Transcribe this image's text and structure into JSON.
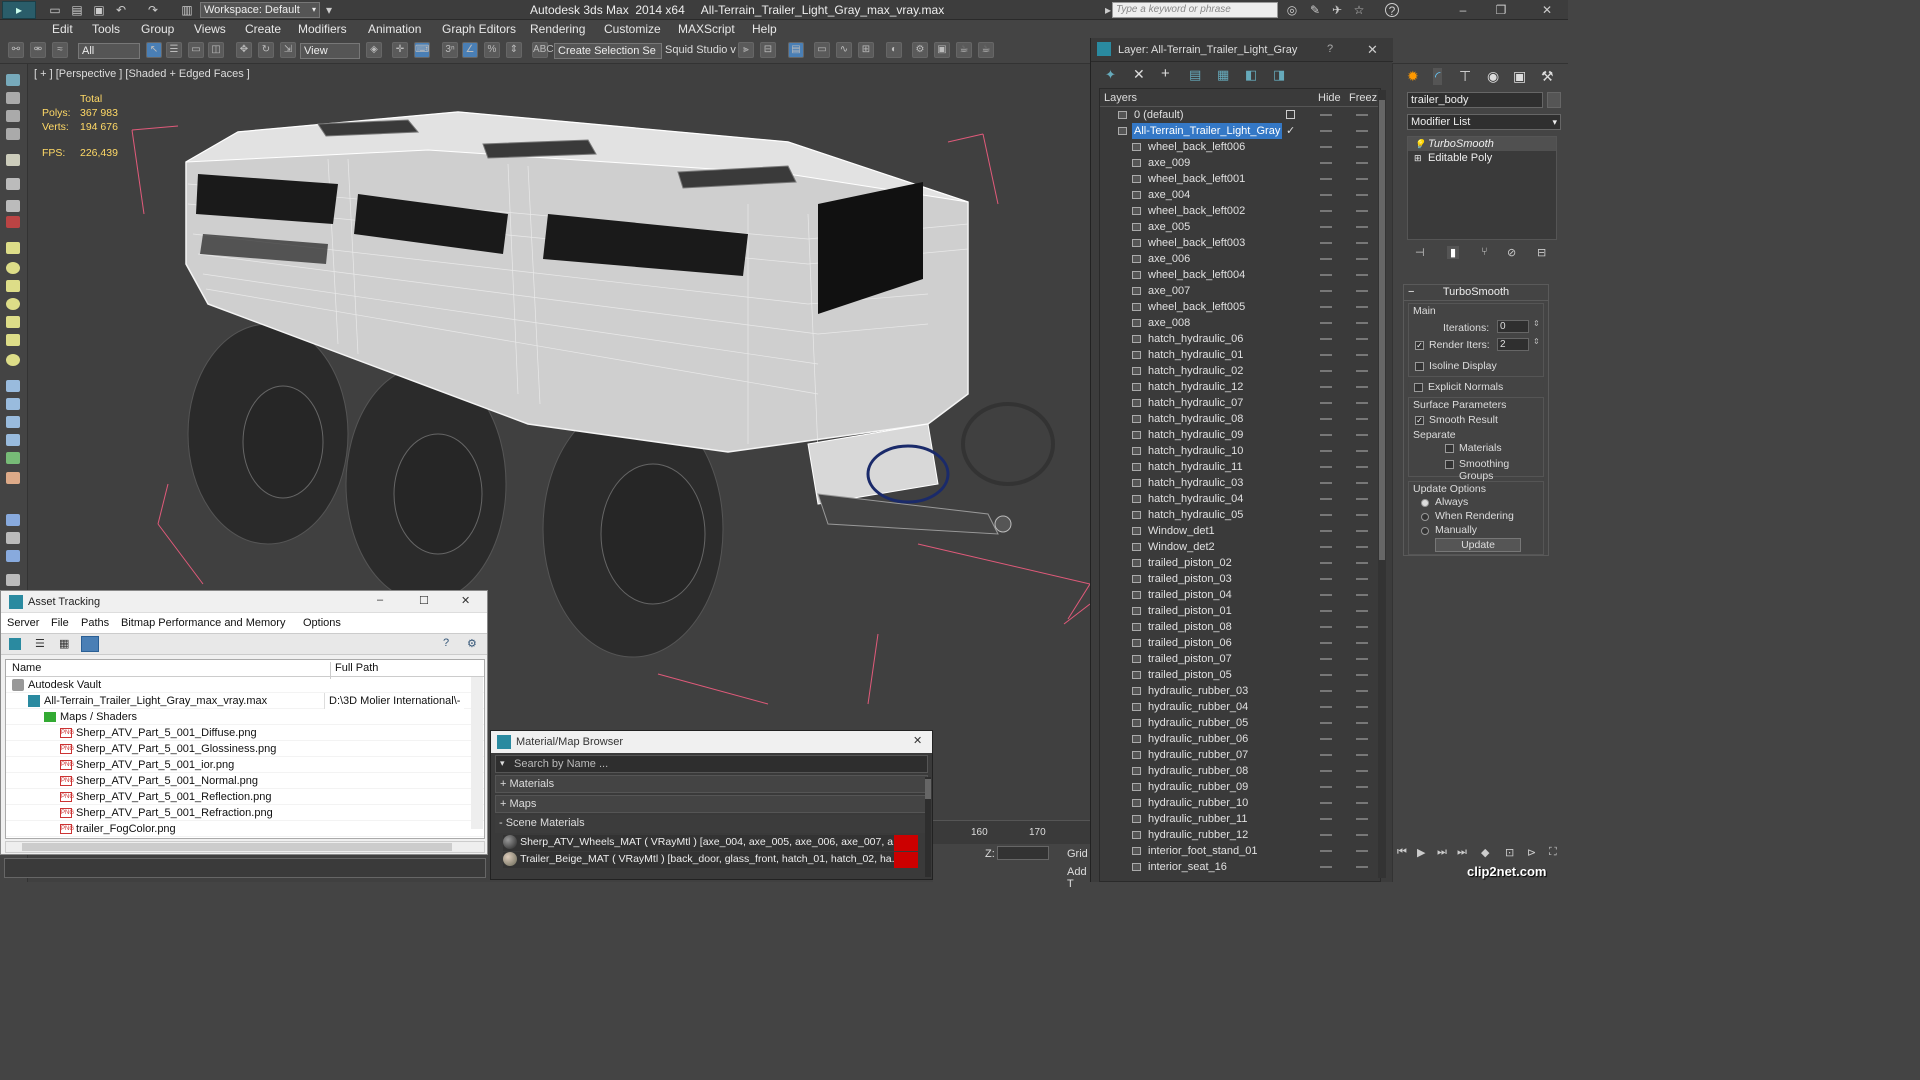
{
  "titlebar": {
    "workspace": "Workspace: Default",
    "title": "Autodesk 3ds Max  2014 x64     All-Terrain_Trailer_Light_Gray_max_vray.max",
    "search_placeholder": "Type a keyword or phrase"
  },
  "menu": [
    "Edit",
    "Tools",
    "Group",
    "Views",
    "Create",
    "Modifiers",
    "Animation",
    "Graph Editors",
    "Rendering",
    "Customize",
    "MAXScript",
    "Help"
  ],
  "toolbar": {
    "filter_value": "All",
    "view_value": "View",
    "selection_set": "Create Selection Se",
    "studio_label": "Squid Studio v"
  },
  "viewport": {
    "label": "[ + ] [Perspective ] [Shaded + Edged Faces ]",
    "stats": {
      "total_label": "Total",
      "polys_label": "Polys:",
      "polys_value": "367 983",
      "verts_label": "Verts:",
      "verts_value": "194 676",
      "fps_label": "FPS:",
      "fps_value": "226,439"
    }
  },
  "layer_panel": {
    "title": "Layer: All-Terrain_Trailer_Light_Gray",
    "col_layers": "Layers",
    "col_hide": "Hide",
    "col_freeze": "Freez",
    "layers": [
      {
        "name": "0 (default)",
        "indent": 1,
        "selected": false
      },
      {
        "name": "All-Terrain_Trailer_Light_Gray",
        "indent": 1,
        "selected": true
      },
      {
        "name": "wheel_back_left006",
        "indent": 2
      },
      {
        "name": "axe_009",
        "indent": 2
      },
      {
        "name": "wheel_back_left001",
        "indent": 2
      },
      {
        "name": "axe_004",
        "indent": 2
      },
      {
        "name": "wheel_back_left002",
        "indent": 2
      },
      {
        "name": "axe_005",
        "indent": 2
      },
      {
        "name": "wheel_back_left003",
        "indent": 2
      },
      {
        "name": "axe_006",
        "indent": 2
      },
      {
        "name": "wheel_back_left004",
        "indent": 2
      },
      {
        "name": "axe_007",
        "indent": 2
      },
      {
        "name": "wheel_back_left005",
        "indent": 2
      },
      {
        "name": "axe_008",
        "indent": 2
      },
      {
        "name": "hatch_hydraulic_06",
        "indent": 2
      },
      {
        "name": "hatch_hydraulic_01",
        "indent": 2
      },
      {
        "name": "hatch_hydraulic_02",
        "indent": 2
      },
      {
        "name": "hatch_hydraulic_12",
        "indent": 2
      },
      {
        "name": "hatch_hydraulic_07",
        "indent": 2
      },
      {
        "name": "hatch_hydraulic_08",
        "indent": 2
      },
      {
        "name": "hatch_hydraulic_09",
        "indent": 2
      },
      {
        "name": "hatch_hydraulic_10",
        "indent": 2
      },
      {
        "name": "hatch_hydraulic_11",
        "indent": 2
      },
      {
        "name": "hatch_hydraulic_03",
        "indent": 2
      },
      {
        "name": "hatch_hydraulic_04",
        "indent": 2
      },
      {
        "name": "hatch_hydraulic_05",
        "indent": 2
      },
      {
        "name": "Window_det1",
        "indent": 2
      },
      {
        "name": "Window_det2",
        "indent": 2
      },
      {
        "name": "trailed_piston_02",
        "indent": 2
      },
      {
        "name": "trailed_piston_03",
        "indent": 2
      },
      {
        "name": "trailed_piston_04",
        "indent": 2
      },
      {
        "name": "trailed_piston_01",
        "indent": 2
      },
      {
        "name": "trailed_piston_08",
        "indent": 2
      },
      {
        "name": "trailed_piston_06",
        "indent": 2
      },
      {
        "name": "trailed_piston_07",
        "indent": 2
      },
      {
        "name": "trailed_piston_05",
        "indent": 2
      },
      {
        "name": "hydraulic_rubber_03",
        "indent": 2
      },
      {
        "name": "hydraulic_rubber_04",
        "indent": 2
      },
      {
        "name": "hydraulic_rubber_05",
        "indent": 2
      },
      {
        "name": "hydraulic_rubber_06",
        "indent": 2
      },
      {
        "name": "hydraulic_rubber_07",
        "indent": 2
      },
      {
        "name": "hydraulic_rubber_08",
        "indent": 2
      },
      {
        "name": "hydraulic_rubber_09",
        "indent": 2
      },
      {
        "name": "hydraulic_rubber_10",
        "indent": 2
      },
      {
        "name": "hydraulic_rubber_11",
        "indent": 2
      },
      {
        "name": "hydraulic_rubber_12",
        "indent": 2
      },
      {
        "name": "interior_foot_stand_01",
        "indent": 2
      },
      {
        "name": "interior_seat_16",
        "indent": 2
      }
    ]
  },
  "command_panel": {
    "object_name": "trailer_body",
    "modifier_list": "Modifier List",
    "stack": [
      "TurboSmooth",
      "Editable Poly"
    ],
    "rollout_title": "TurboSmooth",
    "main_label": "Main",
    "iterations_label": "Iterations:",
    "iterations_value": "0",
    "render_iters_label": "Render Iters:",
    "render_iters_value": "2",
    "isoline_label": "Isoline Display",
    "explicit_label": "Explicit Normals",
    "surface_label": "Surface Parameters",
    "smooth_label": "Smooth Result",
    "separate_label": "Separate",
    "materials_label": "Materials",
    "smoothing_label": "Smoothing Groups",
    "update_label": "Update Options",
    "always_label": "Always",
    "when_rendering_label": "When Rendering",
    "manually_label": "Manually",
    "update_button": "Update"
  },
  "asset_tracking": {
    "title": "Asset Tracking",
    "menu": [
      "Server",
      "File",
      "Paths",
      "Bitmap Performance and Memory",
      "Options"
    ],
    "col_name": "Name",
    "col_path": "Full Path",
    "rows": [
      {
        "name": "Autodesk Vault",
        "path": "",
        "indent": 0,
        "icon": "vault"
      },
      {
        "name": "All-Terrain_Trailer_Light_Gray_max_vray.max",
        "path": "D:\\3D Molier International\\-",
        "indent": 1,
        "icon": "max"
      },
      {
        "name": "Maps / Shaders",
        "path": "",
        "indent": 2,
        "icon": "folder"
      },
      {
        "name": "Sherp_ATV_Part_5_001_Diffuse.png",
        "path": "",
        "indent": 3,
        "icon": "png"
      },
      {
        "name": "Sherp_ATV_Part_5_001_Glossiness.png",
        "path": "",
        "indent": 3,
        "icon": "png"
      },
      {
        "name": "Sherp_ATV_Part_5_001_ior.png",
        "path": "",
        "indent": 3,
        "icon": "png"
      },
      {
        "name": "Sherp_ATV_Part_5_001_Normal.png",
        "path": "",
        "indent": 3,
        "icon": "png"
      },
      {
        "name": "Sherp_ATV_Part_5_001_Reflection.png",
        "path": "",
        "indent": 3,
        "icon": "png"
      },
      {
        "name": "Sherp_ATV_Part_5_001_Refraction.png",
        "path": "",
        "indent": 3,
        "icon": "png"
      },
      {
        "name": "trailer_FogColor.png",
        "path": "",
        "indent": 3,
        "icon": "png"
      }
    ]
  },
  "material_browser": {
    "title": "Material/Map Browser",
    "search_placeholder": "Search by Name ...",
    "groups": [
      "+ Materials",
      "+ Maps",
      "- Scene Materials"
    ],
    "materials": [
      "Sherp_ATV_Wheels_MAT  ( VRayMtl )  [axe_004, axe_005, axe_006, axe_007, a...",
      "Trailer_Beige_MAT  ( VRayMtl )  [back_door, glass_front, hatch_01, hatch_02, ha..."
    ]
  },
  "timeline": {
    "ticks": [
      "160",
      "170"
    ],
    "z_label": "Z:",
    "grid_label": "Grid",
    "add_label": "Add T"
  },
  "watermark": "clip2net.com"
}
